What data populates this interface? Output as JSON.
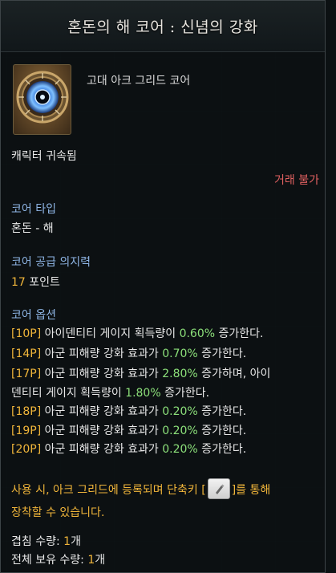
{
  "title": "혼돈의 해 코어 : 신념의 강화",
  "item": {
    "grade_name": "고대 아크 그리드 코어",
    "icon": "chaos-sun-core-icon"
  },
  "binding": "캐릭터 귀속됨",
  "trade": "거래 불가",
  "core_type": {
    "label": "코어 타입",
    "value": "혼돈 - 해"
  },
  "willpower": {
    "label": "코어 공급 의지력",
    "amount": "17",
    "unit": " 포인트"
  },
  "options": {
    "label": "코어 옵션",
    "lines": [
      {
        "tag": "[10P]",
        "text_a": " 아이덴티티 게이지 획득량이 ",
        "pct": "0.60%",
        "text_b": " 증가한다."
      },
      {
        "tag": "[14P]",
        "text_a": " 아군 피해량 강화 효과가 ",
        "pct": "0.70%",
        "text_b": " 증가한다."
      },
      {
        "tag": "[17P]",
        "text_a": " 아군 피해량 강화 효과가 ",
        "pct": "2.80%",
        "text_b": " 증가하며, 아이"
      },
      {
        "tag": "",
        "text_a": "덴티티 게이지 획득량이 ",
        "pct": "1.80%",
        "text_b": " 증가한다."
      },
      {
        "tag": "[18P]",
        "text_a": " 아군 피해량 강화 효과가 ",
        "pct": "0.20%",
        "text_b": " 증가한다."
      },
      {
        "tag": "[19P]",
        "text_a": " 아군 피해량 강화 효과가 ",
        "pct": "0.20%",
        "text_b": " 증가한다."
      },
      {
        "tag": "[20P]",
        "text_a": " 아군 피해량 강화 효과가 ",
        "pct": "0.20%",
        "text_b": " 증가한다."
      }
    ]
  },
  "usage": {
    "line1_a": "사용 시, 아크 그리드에 등록되며 단축키 [",
    "line1_b": "]를 통해",
    "line2": "장착할 수 있습니다.",
    "key_icon": "pencil-key-icon"
  },
  "stack": {
    "label": "겹침 수량: ",
    "value": "1",
    "unit": "개"
  },
  "total": {
    "label": "전체 보유 수량: ",
    "value": "1",
    "unit": "개"
  },
  "colors": {
    "gold": "#f0b53a",
    "blue_label": "#8fb6e6",
    "trade_red": "#e06060",
    "pct_green": "#8ce07a"
  }
}
